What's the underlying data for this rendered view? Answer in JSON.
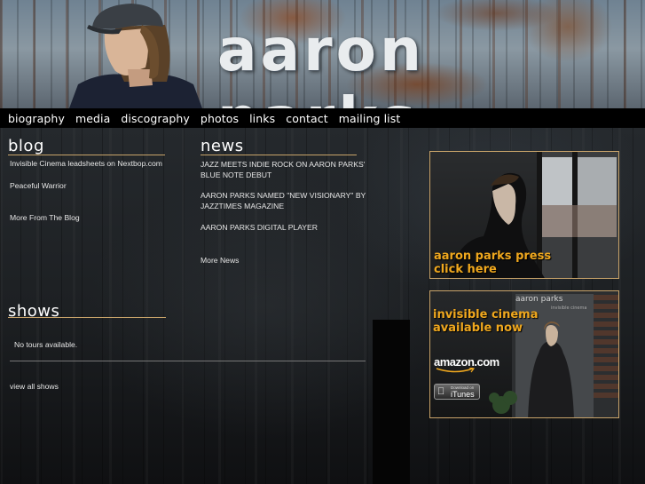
{
  "header": {
    "site_title": "aaron parks"
  },
  "nav": {
    "items": [
      {
        "label": "biography"
      },
      {
        "label": "media"
      },
      {
        "label": "discography"
      },
      {
        "label": "photos"
      },
      {
        "label": "links"
      },
      {
        "label": "contact"
      },
      {
        "label": "mailing list"
      }
    ]
  },
  "blog": {
    "heading": "blog",
    "posts": [
      {
        "title": "Invisible Cinema leadsheets on Nextbop.com"
      },
      {
        "title": "Peaceful Warrior"
      }
    ],
    "more_link": "More From The Blog"
  },
  "news": {
    "heading": "news",
    "items": [
      {
        "line1": "JAZZ MEETS INDIE ROCK ON AARON PARKS'",
        "line2": "BLUE NOTE DEBUT"
      },
      {
        "line1": "AARON PARKS NAMED \"NEW VISIONARY\" BY",
        "line2": "JAZZTIMES MAGAZINE"
      },
      {
        "line1": "AARON PARKS DIGITAL PLAYER",
        "line2": ""
      }
    ],
    "more_link": "More News"
  },
  "shows": {
    "heading": "shows",
    "empty_message": "No tours available.",
    "view_all_link": "view all shows"
  },
  "promos": {
    "press": {
      "line1": "aaron parks press",
      "line2": "click here"
    },
    "album": {
      "line1": "invisible cinema",
      "line2": "available now",
      "cover_artist": "aaron parks",
      "cover_title": "invisible cinema",
      "amazon_label": "amazon.com",
      "itunes_small": "Download on",
      "itunes_label": "iTunes"
    }
  },
  "colors": {
    "accent_rule": "#c9a46a",
    "promo_text": "#f0a81e",
    "nav_bg": "#000000"
  }
}
